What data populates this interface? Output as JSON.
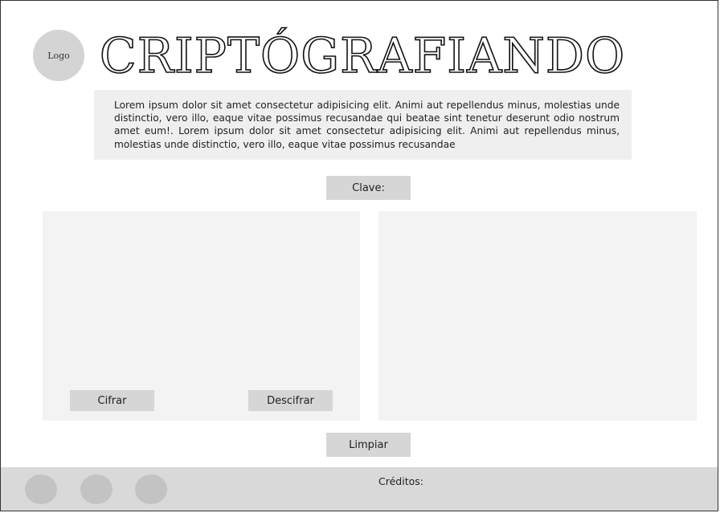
{
  "header": {
    "logo_label": "Logo",
    "title": "CRIPTÓGRAFIANDO"
  },
  "intro": {
    "text": "Lorem ipsum dolor sit amet consectetur adipisicing elit. Animi aut repellendus minus, molestias unde distinctio, vero illo, eaque vitae possimus recusandae qui beatae sint tenetur deserunt odio nostrum amet eum!. Lorem ipsum dolor sit amet consectetur adipisicing elit. Animi aut repellendus minus, molestias unde distinctio, vero illo, eaque vitae possimus recusandae"
  },
  "controls": {
    "key_label": "Clave:",
    "encrypt_label": "Cifrar",
    "decrypt_label": "Descifrar",
    "clear_label": "Limpiar"
  },
  "footer": {
    "credits_label": "Créditos:",
    "social_icons": [
      "social-icon-1",
      "social-icon-2",
      "social-icon-3"
    ]
  },
  "colors": {
    "background": "#ffffff",
    "panel": "#f3f3f3",
    "intro_bg": "#efefef",
    "button": "#d6d6d6",
    "footer": "#d9d9d9",
    "logo": "#d4d4d4"
  }
}
